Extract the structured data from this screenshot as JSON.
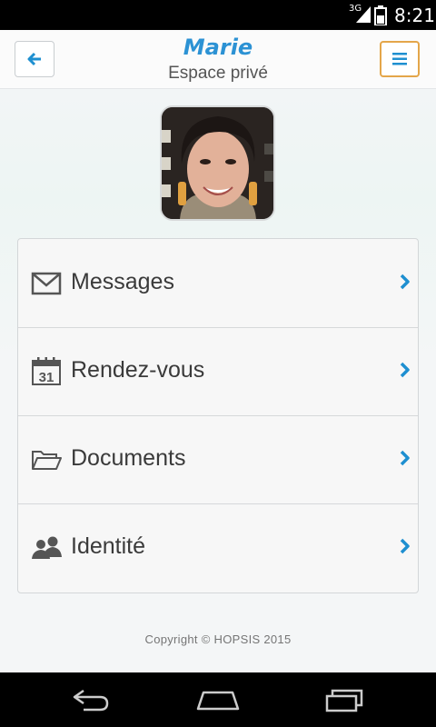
{
  "status_bar": {
    "network": "3G",
    "time": "8:21"
  },
  "header": {
    "title": "Marie",
    "subtitle": "Espace privé"
  },
  "menu": {
    "items": [
      {
        "label": "Messages",
        "icon": "envelope-icon"
      },
      {
        "label": "Rendez-vous",
        "icon": "calendar-icon",
        "icon_text": "31"
      },
      {
        "label": "Documents",
        "icon": "folder-icon"
      },
      {
        "label": "Identité",
        "icon": "people-icon"
      }
    ]
  },
  "footer": {
    "copyright": "Copyright © HOPSIS 2015"
  },
  "colors": {
    "accent": "#2c92d4",
    "chevron": "#1e8fd0",
    "menu_border": "#e4a64a"
  }
}
